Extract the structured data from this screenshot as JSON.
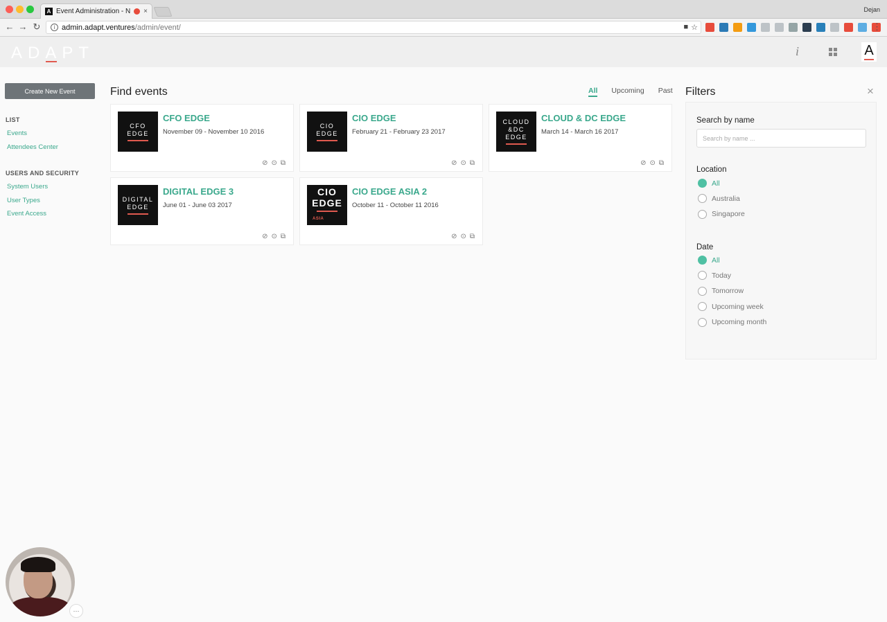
{
  "browser": {
    "tab_title": "Event Administration - Nex",
    "tab_favicon": "A",
    "tab_close": "×",
    "profile_name": "Dejan",
    "url_host": "admin.adapt.ventures",
    "url_path": "/admin/event/",
    "nav_back": "←",
    "nav_forward": "→",
    "nav_reload": "↻",
    "menu": "⋮",
    "extensions": [
      "#e74c3c",
      "#2c7bb6",
      "#f39c12",
      "#3498db",
      "#bdc3c7",
      "#bdc3c7",
      "#95a5a6",
      "#2c3e50",
      "#2980b9",
      "#bdc3c7",
      "#e74c3c",
      "#5dade2",
      "#e74c3c"
    ]
  },
  "header": {
    "logo": "ADAPT",
    "info_glyph": "i",
    "avatar_letter": "A"
  },
  "sidebar": {
    "create_button": "Create New Event",
    "sections": [
      {
        "heading": "LIST",
        "items": [
          "Events",
          "Attendees Center"
        ]
      },
      {
        "heading": "USERS AND SECURITY",
        "items": [
          "System Users",
          "User Types",
          "Event Access"
        ]
      }
    ]
  },
  "main": {
    "title": "Find events",
    "tabs": [
      {
        "label": "All",
        "active": true
      },
      {
        "label": "Upcoming",
        "active": false
      },
      {
        "label": "Past",
        "active": false
      }
    ],
    "events": [
      {
        "title": "CFO EDGE",
        "dates": "November 09 - November 10 2016",
        "logo_lines": [
          "CFO",
          "EDGE"
        ],
        "logo_sub": ""
      },
      {
        "title": "CIO EDGE",
        "dates": "February 21 - February 23 2017",
        "logo_lines": [
          "CIO",
          "EDGE"
        ],
        "logo_sub": ""
      },
      {
        "title": "CLOUD & DC EDGE",
        "dates": "March 14 - March 16 2017",
        "logo_lines": [
          "CLOUD",
          "&DC",
          "EDGE"
        ],
        "logo_sub": ""
      },
      {
        "title": "DIGITAL EDGE 3",
        "dates": "June 01 - June 03 2017",
        "logo_lines": [
          "DIGITAL",
          "EDGE"
        ],
        "logo_sub": ""
      },
      {
        "title": "CIO EDGE ASIA 2",
        "dates": "October 11 - October 11 2016",
        "logo_lines": [
          "CIO",
          "EDGE"
        ],
        "logo_sub": "ASIA"
      }
    ],
    "card_action_icons": [
      "paperclip-icon",
      "clock-icon",
      "share-icon"
    ]
  },
  "filters": {
    "title": "Filters",
    "close": "×",
    "search_label": "Search by name",
    "search_placeholder": "Search by name ...",
    "location_label": "Location",
    "location_options": [
      {
        "label": "All",
        "checked": true
      },
      {
        "label": "Australia",
        "checked": false
      },
      {
        "label": "Singapore",
        "checked": false
      }
    ],
    "date_label": "Date",
    "date_options": [
      {
        "label": "All",
        "checked": true
      },
      {
        "label": "Today",
        "checked": false
      },
      {
        "label": "Tomorrow",
        "checked": false
      },
      {
        "label": "Upcoming week",
        "checked": false
      },
      {
        "label": "Upcoming month",
        "checked": false
      }
    ]
  },
  "webcam": {
    "menu_glyph": "···"
  }
}
